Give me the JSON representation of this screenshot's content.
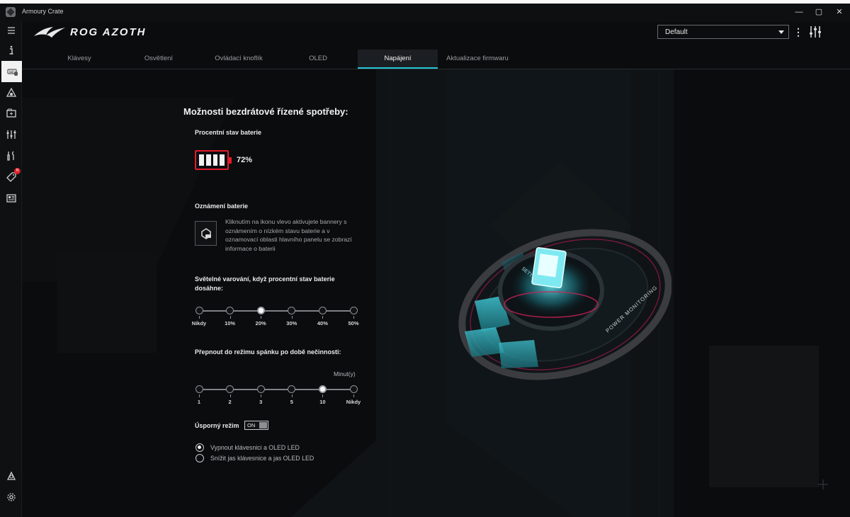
{
  "window": {
    "title": "Armoury Crate",
    "minimize": "—",
    "maximize": "▢",
    "close": "✕"
  },
  "header": {
    "device_name": "ROG AZOTH",
    "profile": "Default"
  },
  "rail": {
    "badge": "N"
  },
  "tabs": [
    {
      "label": "Klávesy"
    },
    {
      "label": "Osvětlení"
    },
    {
      "label": "Ovládací knoflík"
    },
    {
      "label": "OLED"
    },
    {
      "label": "Napájení"
    },
    {
      "label": "Aktualizace firmwaru"
    }
  ],
  "power": {
    "title": "Možnosti bezdrátové řízené spotřeby:",
    "battery_label": "Procentní stav baterie",
    "battery_percent": "72%",
    "notify_label": "Oznámení baterie",
    "notify_text": "Kliknutím na ikonu vlevo aktivujete bannery s oznámením o nízkém stavu baterie a v oznamovací oblasti hlavního panelu se zobrazí informace o baterii",
    "light_warning_label": "Světelné varování, když procentní stav baterie dosáhne:",
    "light_warning_options": [
      "Nikdy",
      "10%",
      "20%",
      "30%",
      "40%",
      "50%"
    ],
    "light_warning_selected_index": 2,
    "sleep_label": "Přepnout do režimu spánku po době nečinnosti:",
    "sleep_unit": "Minut(y)",
    "sleep_options": [
      "1",
      "2",
      "3",
      "5",
      "10",
      "Nikdy"
    ],
    "sleep_selected_index": 4,
    "eco_label": "Úsporný režim",
    "eco_toggle": "ON",
    "eco_options": [
      "Vypnout klávesnici a OLED LED",
      "Snížit jas klávesnice a jas OLED LED"
    ],
    "eco_selected_index": 0
  },
  "hero": {
    "ring_text": "POWER MONITORING",
    "inner_text": "SETTING"
  },
  "colors": {
    "accent": "#22c6d6",
    "battery": "#e31c2a",
    "background": "#0b0c0e"
  }
}
